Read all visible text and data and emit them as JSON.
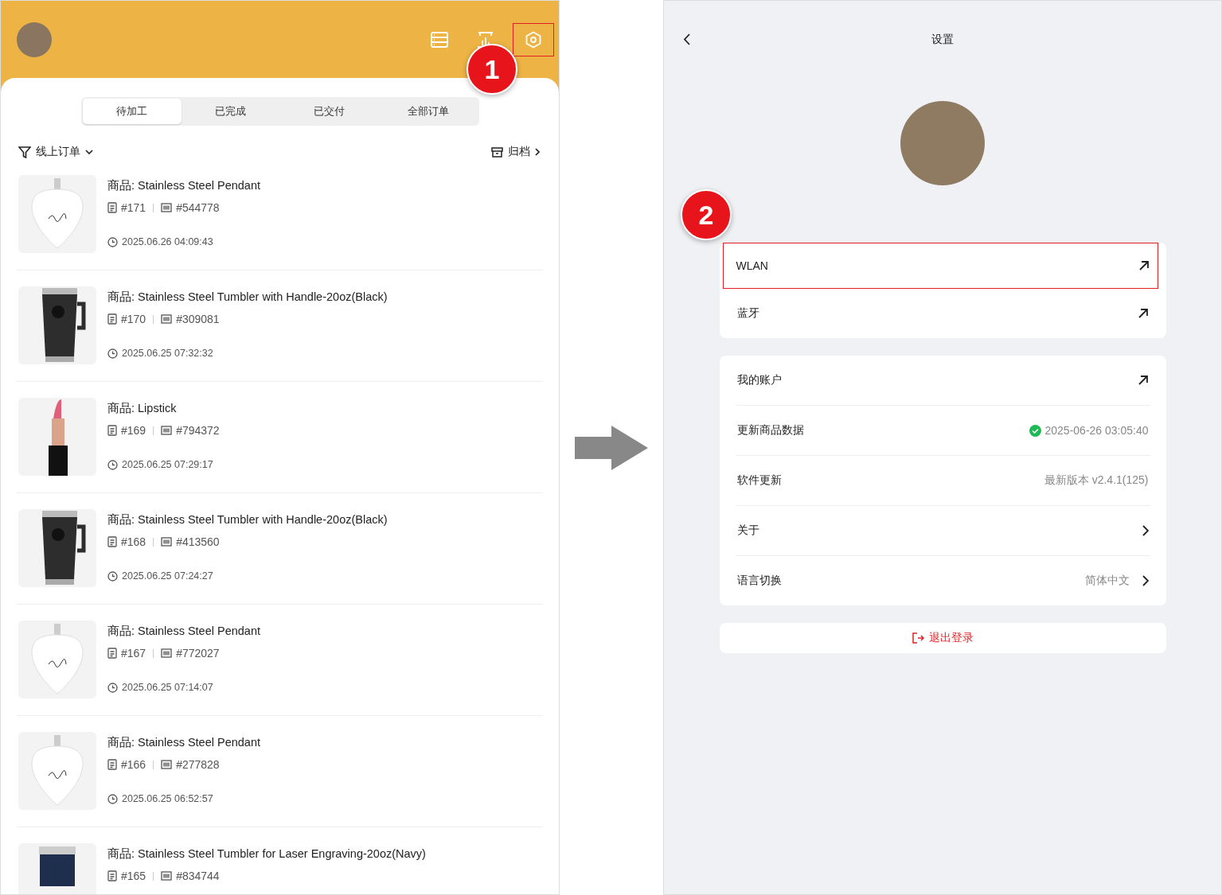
{
  "orders_screen": {
    "header": {
      "icons": [
        {
          "kind": "list",
          "highlighted": false
        },
        {
          "kind": "chart",
          "highlighted": false
        },
        {
          "kind": "settings",
          "highlighted": true
        }
      ]
    },
    "tabs": [
      {
        "label": "待加工",
        "selected": true
      },
      {
        "label": "已完成",
        "selected": false
      },
      {
        "label": "已交付",
        "selected": false
      },
      {
        "label": "全部订单",
        "selected": false
      }
    ],
    "filter": {
      "label": "线上订单"
    },
    "archive": {
      "label": "归档"
    },
    "orders": [
      {
        "kind": "pendant",
        "product": "商品: Stainless Steel Pendant",
        "order_no": "#171",
        "code": "#544778",
        "time": "2025.06.26 04:09:43"
      },
      {
        "kind": "tumbler",
        "product": "商品: Stainless Steel Tumbler with Handle-20oz(Black)",
        "order_no": "#170",
        "code": "#309081",
        "time": "2025.06.25 07:32:32"
      },
      {
        "kind": "lipstick",
        "product": "商品: Lipstick",
        "order_no": "#169",
        "code": "#794372",
        "time": "2025.06.25 07:29:17"
      },
      {
        "kind": "tumbler",
        "product": "商品: Stainless Steel Tumbler with Handle-20oz(Black)",
        "order_no": "#168",
        "code": "#413560",
        "time": "2025.06.25 07:24:27"
      },
      {
        "kind": "pendant",
        "product": "商品: Stainless Steel Pendant",
        "order_no": "#167",
        "code": "#772027",
        "time": "2025.06.25 07:14:07"
      },
      {
        "kind": "pendant",
        "product": "商品: Stainless Steel Pendant",
        "order_no": "#166",
        "code": "#277828",
        "time": "2025.06.25 06:52:57"
      },
      {
        "kind": "cup",
        "product": "商品: Stainless Steel Tumbler for Laser Engraving-20oz(Navy)",
        "order_no": "#165",
        "code": "#834744"
      }
    ]
  },
  "settings_screen": {
    "title": "设置",
    "groups": [
      [
        {
          "kind": "link",
          "label": "WLAN",
          "highlighted": true
        },
        {
          "kind": "link",
          "label": "蓝牙",
          "highlighted": false
        }
      ],
      [
        {
          "kind": "link",
          "label": "我的账户",
          "highlighted": false
        },
        {
          "kind": "status",
          "label": "更新商品数据",
          "value": "2025-06-26 03:05:40",
          "highlighted": false
        },
        {
          "kind": "value",
          "label": "软件更新",
          "value": "最新版本 v2.4.1(125)",
          "highlighted": false
        },
        {
          "kind": "chevron",
          "label": "关于",
          "highlighted": false
        },
        {
          "kind": "chevron",
          "label": "语言切换",
          "value": "简体中文",
          "highlighted": false
        }
      ]
    ],
    "logout": {
      "label": "退出登录"
    }
  },
  "callouts": [
    {
      "label": "1"
    },
    {
      "label": "2"
    }
  ]
}
